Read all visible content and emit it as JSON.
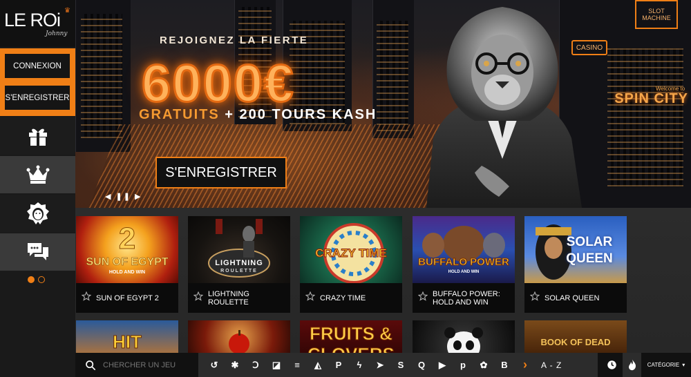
{
  "brand": {
    "logo_text": "LE ROi",
    "logo_sub": "Johnny"
  },
  "auth": {
    "login_label": "CONNEXION",
    "register_label": "S'ENREGISTRER"
  },
  "sidebar": {
    "items": [
      {
        "icon": "gift-icon"
      },
      {
        "icon": "crown-icon"
      },
      {
        "icon": "lion-icon"
      },
      {
        "icon": "chat-icon"
      }
    ]
  },
  "hero": {
    "tagline": "REJOIGNEZ LA FIERTE",
    "amount": "6000€",
    "offer_part1": "GRATUITS",
    "offer_part2": " + 200 TOURS KASH",
    "cta_label": "S'ENREGISTRER",
    "slide_controls": "◀ ❚❚ ▶",
    "signs": {
      "slot": "SLOT MACHINE",
      "casino": "CASINO",
      "spin_city": "SPIN CITY",
      "welcome": "Welcome to"
    }
  },
  "slider": {
    "active_index": 0,
    "count": 2
  },
  "games": [
    {
      "name": "SUN OF EGYPT 2",
      "thumb_text": "SUN OF EGYPT",
      "sub": "HOLD AND WIN",
      "badge": "2"
    },
    {
      "name": "LIGHTNING ROULETTE",
      "thumb_text": "LIGHTNING",
      "sub": "ROULETTE"
    },
    {
      "name": "CRAZY TIME",
      "thumb_text": "CRAZY TIME"
    },
    {
      "name": "BUFFALO POWER: HOLD AND WIN",
      "thumb_text": "BUFFALO POWER",
      "sub": "HOLD AND WIN"
    },
    {
      "name": "SOLAR QUEEN",
      "thumb_text": "SOLAR QUEEN"
    }
  ],
  "games_row2": [
    {
      "thumb_text": "HIT"
    },
    {
      "thumb_text": ""
    },
    {
      "thumb_text": "FRUITS & CLOVERS"
    },
    {
      "thumb_text": ""
    },
    {
      "thumb_text": "BOOK OF DEAD"
    }
  ],
  "bottombar": {
    "search_placeholder": "CHERCHER UN JEU",
    "providers": [
      "↺",
      "✱",
      "Ↄ",
      "◪",
      "≡",
      "◭",
      "P",
      "ϟ",
      "➤",
      "S",
      "Q",
      "▶",
      "p",
      "✿",
      "B"
    ],
    "next_icon": "›",
    "az_label": "A - Z",
    "category_label": "CATÉGORIE",
    "category_arrow": "▾"
  },
  "colors": {
    "accent": "#f07f16",
    "sidebar": "#1c1c1c",
    "card_bg": "#0b0b0b"
  }
}
